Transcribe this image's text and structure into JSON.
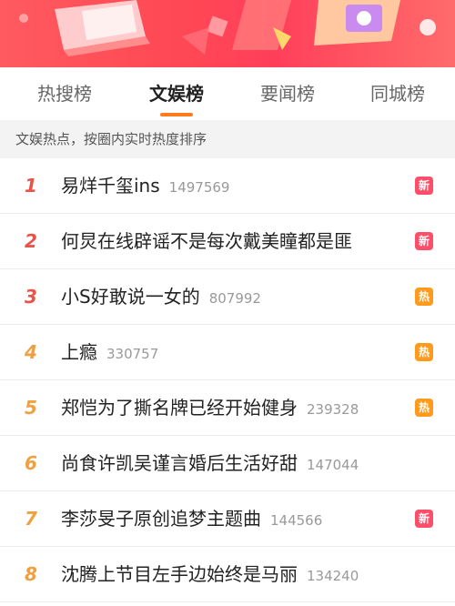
{
  "tabs": [
    {
      "label": "热搜榜"
    },
    {
      "label": "文娱榜"
    },
    {
      "label": "要闻榜"
    },
    {
      "label": "同城榜"
    }
  ],
  "active_tab": 1,
  "subheader": {
    "text": "文娱热点，按圈内实时热度排序"
  },
  "colors": {
    "accent": "#ff7a1a",
    "badge_new": "#ff4e6a",
    "badge_hot": "#ff9a1c",
    "rank_top": "#e8534a",
    "rank_mid": "#f0a040"
  },
  "items": [
    {
      "rank": "1",
      "title": "易烊千玺ins",
      "count": "1497569",
      "badge": "新",
      "badge_type": "new"
    },
    {
      "rank": "2",
      "title": "何炅在线辟谣不是每次戴美瞳都是匪",
      "count": "",
      "badge": "新",
      "badge_type": "new"
    },
    {
      "rank": "3",
      "title": "小S好敢说一女的",
      "count": "807992",
      "badge": "热",
      "badge_type": "hot"
    },
    {
      "rank": "4",
      "title": "上瘾",
      "count": "330757",
      "badge": "热",
      "badge_type": "hot"
    },
    {
      "rank": "5",
      "title": "郑恺为了撕名牌已经开始健身",
      "count": "239328",
      "badge": "热",
      "badge_type": "hot"
    },
    {
      "rank": "6",
      "title": "尚食许凯吴谨言婚后生活好甜",
      "count": "147044",
      "badge": "",
      "badge_type": ""
    },
    {
      "rank": "7",
      "title": "李莎旻子原创追梦主题曲",
      "count": "144566",
      "badge": "新",
      "badge_type": "new"
    },
    {
      "rank": "8",
      "title": "沈腾上节目左手边始终是马丽",
      "count": "134240",
      "badge": "",
      "badge_type": ""
    }
  ]
}
